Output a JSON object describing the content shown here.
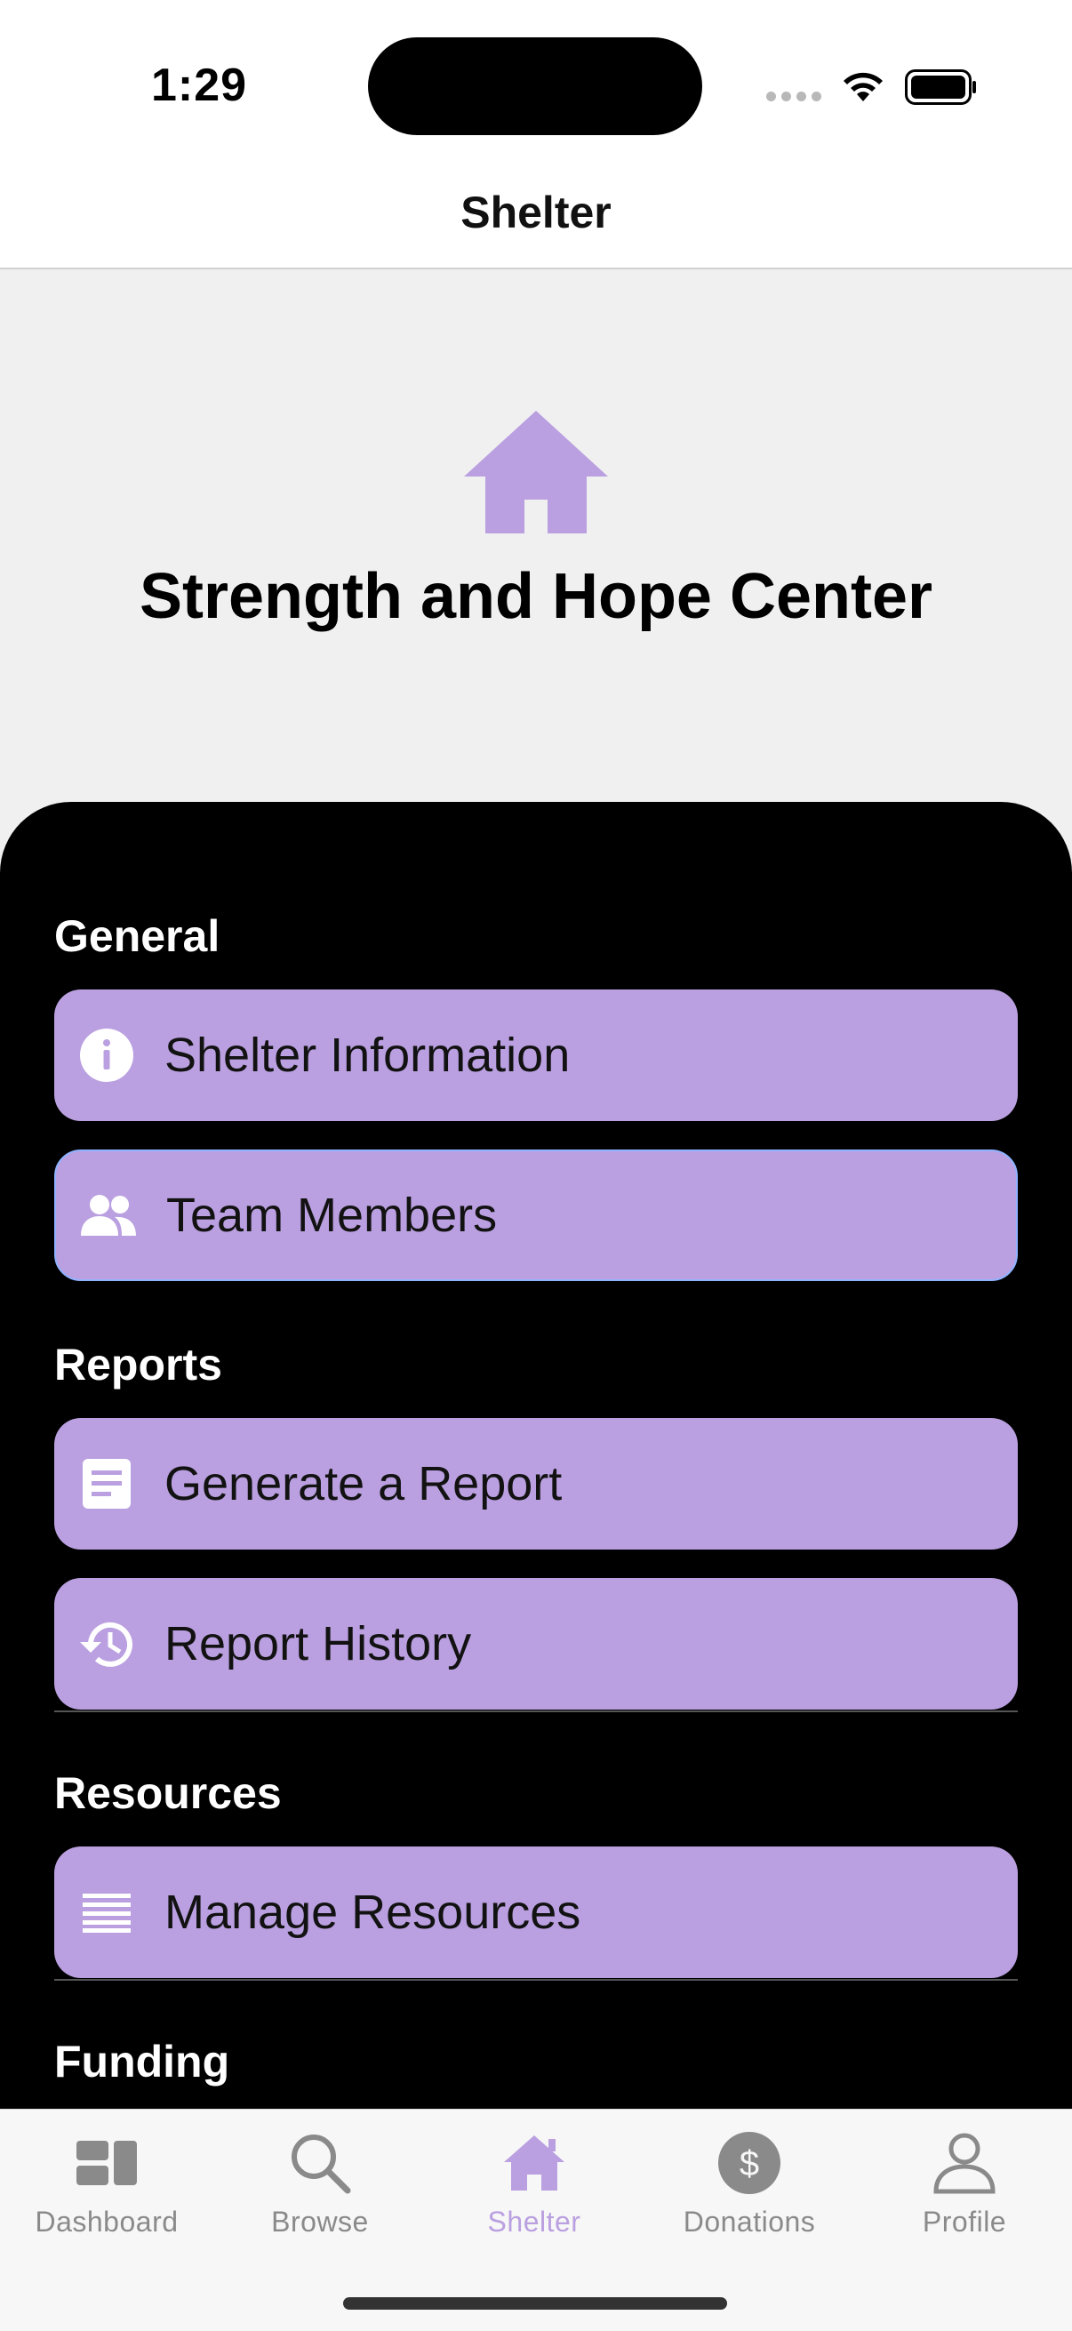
{
  "status": {
    "time": "1:29"
  },
  "nav": {
    "title": "Shelter"
  },
  "header": {
    "icon": "house-icon",
    "center_name": "Strength and Hope Center"
  },
  "sections": {
    "general": {
      "title": "General",
      "items": [
        {
          "label": "Shelter Information",
          "icon": "info-icon"
        },
        {
          "label": "Team Members",
          "icon": "people-icon"
        }
      ]
    },
    "reports": {
      "title": "Reports",
      "items": [
        {
          "label": "Generate a Report",
          "icon": "document-icon"
        },
        {
          "label": "Report History",
          "icon": "history-icon"
        }
      ]
    },
    "resources": {
      "title": "Resources",
      "items": [
        {
          "label": "Manage Resources",
          "icon": "list-icon"
        }
      ]
    },
    "funding": {
      "title": "Funding"
    }
  },
  "tabs": [
    {
      "label": "Dashboard",
      "icon": "dashboard-icon",
      "active": false
    },
    {
      "label": "Browse",
      "icon": "search-icon",
      "active": false
    },
    {
      "label": "Shelter",
      "icon": "house-icon",
      "active": true
    },
    {
      "label": "Donations",
      "icon": "dollar-icon",
      "active": false
    },
    {
      "label": "Profile",
      "icon": "person-icon",
      "active": false
    }
  ],
  "colors": {
    "accent": "#baa0e0",
    "panel": "#000000",
    "background": "#f0f0f0",
    "tab_inactive": "#8a8a8a"
  }
}
